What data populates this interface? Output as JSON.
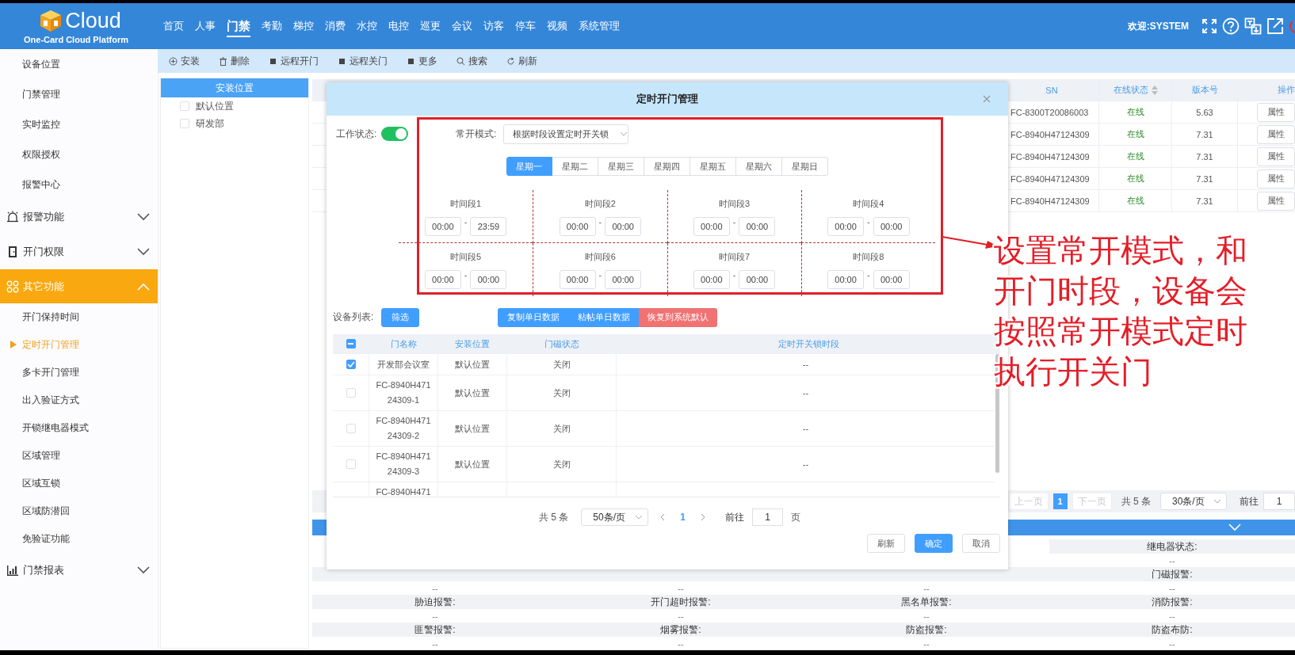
{
  "header": {
    "logo_title": "Cloud",
    "logo_subtitle": "One-Card Cloud Platform",
    "nav": [
      {
        "label": "首页",
        "selected": false
      },
      {
        "label": "人事",
        "selected": false
      },
      {
        "label": "门禁",
        "selected": true
      },
      {
        "label": "考勤",
        "selected": false
      },
      {
        "label": "梯控",
        "selected": false
      },
      {
        "label": "消费",
        "selected": false
      },
      {
        "label": "水控",
        "selected": false
      },
      {
        "label": "电控",
        "selected": false
      },
      {
        "label": "巡更",
        "selected": false
      },
      {
        "label": "会议",
        "selected": false
      },
      {
        "label": "访客",
        "selected": false
      },
      {
        "label": "停车",
        "selected": false
      },
      {
        "label": "视频",
        "selected": false
      },
      {
        "label": "系统管理",
        "selected": false
      }
    ],
    "welcome": "欢迎:SYSTEM"
  },
  "sidebar": {
    "items": [
      {
        "kind": "item",
        "label": "设备位置",
        "selected": false
      },
      {
        "kind": "item",
        "label": "门禁管理",
        "selected": false
      },
      {
        "kind": "item",
        "label": "实时监控",
        "selected": false
      },
      {
        "kind": "item",
        "label": "权限授权",
        "selected": false
      },
      {
        "kind": "item",
        "label": "报警中心",
        "selected": false
      },
      {
        "kind": "group",
        "label": "报警功能",
        "expanded": false
      },
      {
        "kind": "group",
        "label": "开门权限",
        "expanded": false
      },
      {
        "kind": "group",
        "label": "其它功能",
        "expanded": true,
        "children": [
          {
            "label": "开门保持时间",
            "selected": false
          },
          {
            "label": "定时开门管理",
            "selected": true
          },
          {
            "label": "多卡开门管理",
            "selected": false
          },
          {
            "label": "出入验证方式",
            "selected": false
          },
          {
            "label": "开锁继电器模式",
            "selected": false
          },
          {
            "label": "区域管理",
            "selected": false
          },
          {
            "label": "区域互锁",
            "selected": false
          },
          {
            "label": "区域防潜回",
            "selected": false
          },
          {
            "label": "免验证功能",
            "selected": false
          }
        ]
      },
      {
        "kind": "group",
        "label": "门禁报表",
        "expanded": false
      }
    ]
  },
  "toolbar": [
    "安装",
    "删除",
    "远程开门",
    "远程关门",
    "更多",
    "搜索",
    "刷新"
  ],
  "tree": {
    "title": "安装位置",
    "items": [
      {
        "label": "默认位置",
        "checked": false
      },
      {
        "label": "研发部",
        "checked": false
      }
    ]
  },
  "device_table": {
    "columns": [
      {
        "label": "SN",
        "sortable": false
      },
      {
        "label": "在线状态",
        "sortable": true
      },
      {
        "label": "版本号",
        "sortable": false
      },
      {
        "label": "操作",
        "sortable": false
      }
    ],
    "rows": [
      {
        "sn": "FC-8300T20086003",
        "status": "在线",
        "version": "5.63",
        "action": "属性"
      },
      {
        "sn": "FC-8940H47124309",
        "status": "在线",
        "version": "7.31",
        "action": "属性"
      },
      {
        "sn": "FC-8940H47124309",
        "status": "在线",
        "version": "7.31",
        "action": "属性"
      },
      {
        "sn": "FC-8940H47124309",
        "status": "在线",
        "version": "7.31",
        "action": "属性"
      },
      {
        "sn": "FC-8940H47124309",
        "status": "在线",
        "version": "7.31",
        "action": "属性"
      }
    ]
  },
  "device_pagination": {
    "prev": "上一页",
    "pages": [
      {
        "label": "1",
        "selected": true
      }
    ],
    "next": "下一页",
    "total": "共 5 条",
    "page_size": "30条/页",
    "goto_label": "前往",
    "goto_value": "1"
  },
  "details": {
    "fields": [
      {
        "label": "继电器状态:",
        "value": "--"
      },
      {
        "value": "--"
      },
      {
        "value": "--"
      },
      {
        "value": "--"
      },
      {
        "label": "门磁报警:",
        "value": "--"
      },
      {
        "label": "胁迫报警:",
        "value": "--"
      },
      {
        "label": "开门超时报警:",
        "value": "--"
      },
      {
        "label": "黑名单报警:",
        "value": "--"
      },
      {
        "label": "消防报警:",
        "value": "--"
      },
      {
        "label": "匪警报警:",
        "value": "--"
      },
      {
        "label": "烟雾报警:",
        "value": "--"
      },
      {
        "label": "防盗报警:",
        "value": "--"
      },
      {
        "label": "防盗布防:",
        "value": "--"
      }
    ]
  },
  "dialog": {
    "title": "定时开门管理",
    "work_status": {
      "label": "工作状态:",
      "on": true
    },
    "mode": {
      "label": "常开模式:",
      "value": "根据时段设置定时开关锁"
    },
    "weekdays": [
      {
        "label": "星期一",
        "selected": true
      },
      {
        "label": "星期二",
        "selected": false
      },
      {
        "label": "星期三",
        "selected": false
      },
      {
        "label": "星期四",
        "selected": false
      },
      {
        "label": "星期五",
        "selected": false
      },
      {
        "label": "星期六",
        "selected": false
      },
      {
        "label": "星期日",
        "selected": false
      }
    ],
    "segments": [
      {
        "label": "时间段1",
        "start": "00:00",
        "dash": "-",
        "end": "23:59"
      },
      {
        "label": "时间段2",
        "start": "00:00",
        "dash": "-",
        "end": "00:00"
      },
      {
        "label": "时间段3",
        "start": "00:00",
        "dash": "-",
        "end": "00:00"
      },
      {
        "label": "时间段4",
        "start": "00:00",
        "dash": "-",
        "end": "00:00"
      },
      {
        "label": "时间段5",
        "start": "00:00",
        "dash": "-",
        "end": "00:00"
      },
      {
        "label": "时间段6",
        "start": "00:00",
        "dash": "-",
        "end": "00:00"
      },
      {
        "label": "时间段7",
        "start": "00:00",
        "dash": "-",
        "end": "00:00"
      },
      {
        "label": "时间段8",
        "start": "00:00",
        "dash": "-",
        "end": "00:00"
      }
    ],
    "device_list": {
      "label": "设备列表:",
      "filter": "筛选",
      "actions": [
        {
          "label": "复制单日数据",
          "kind": "primary"
        },
        {
          "label": "粘帖单日数据",
          "kind": "primary"
        },
        {
          "label": "恢复到系统默认",
          "kind": "danger"
        }
      ]
    },
    "door_table": {
      "select_all": {
        "indeterminate": true
      },
      "columns": [
        "门名称",
        "安装位置",
        "门磁状态",
        "定时开关锁时段"
      ],
      "rows": [
        {
          "name": "开发部会议室",
          "location": "默认位置",
          "sensor": "关闭",
          "schedule": "--",
          "checked": true
        },
        {
          "name": "FC-8940H47124309-1",
          "location": "默认位置",
          "sensor": "关闭",
          "schedule": "--",
          "checked": false
        },
        {
          "name": "FC-8940H47124309-2",
          "location": "默认位置",
          "sensor": "关闭",
          "schedule": "--",
          "checked": false
        },
        {
          "name": "FC-8940H47124309-3",
          "location": "默认位置",
          "sensor": "关闭",
          "schedule": "--",
          "checked": false
        }
      ],
      "partial_row": {
        "name": "FC-8940H471"
      }
    },
    "pagination": {
      "total": "共 5 条",
      "page_size": "50条/页",
      "pages": [
        {
          "label": "1",
          "selected": true
        }
      ],
      "goto_label": "前往",
      "goto_value": "1",
      "goto_suffix": "页"
    },
    "buttons": [
      {
        "label": "刷新",
        "kind": "default"
      },
      {
        "label": "确定",
        "kind": "primary"
      },
      {
        "label": "取消",
        "kind": "default"
      }
    ]
  },
  "annotation": {
    "text": "设置常开模式，和开门时段，设备会按照常开模式定时执行开关门"
  }
}
